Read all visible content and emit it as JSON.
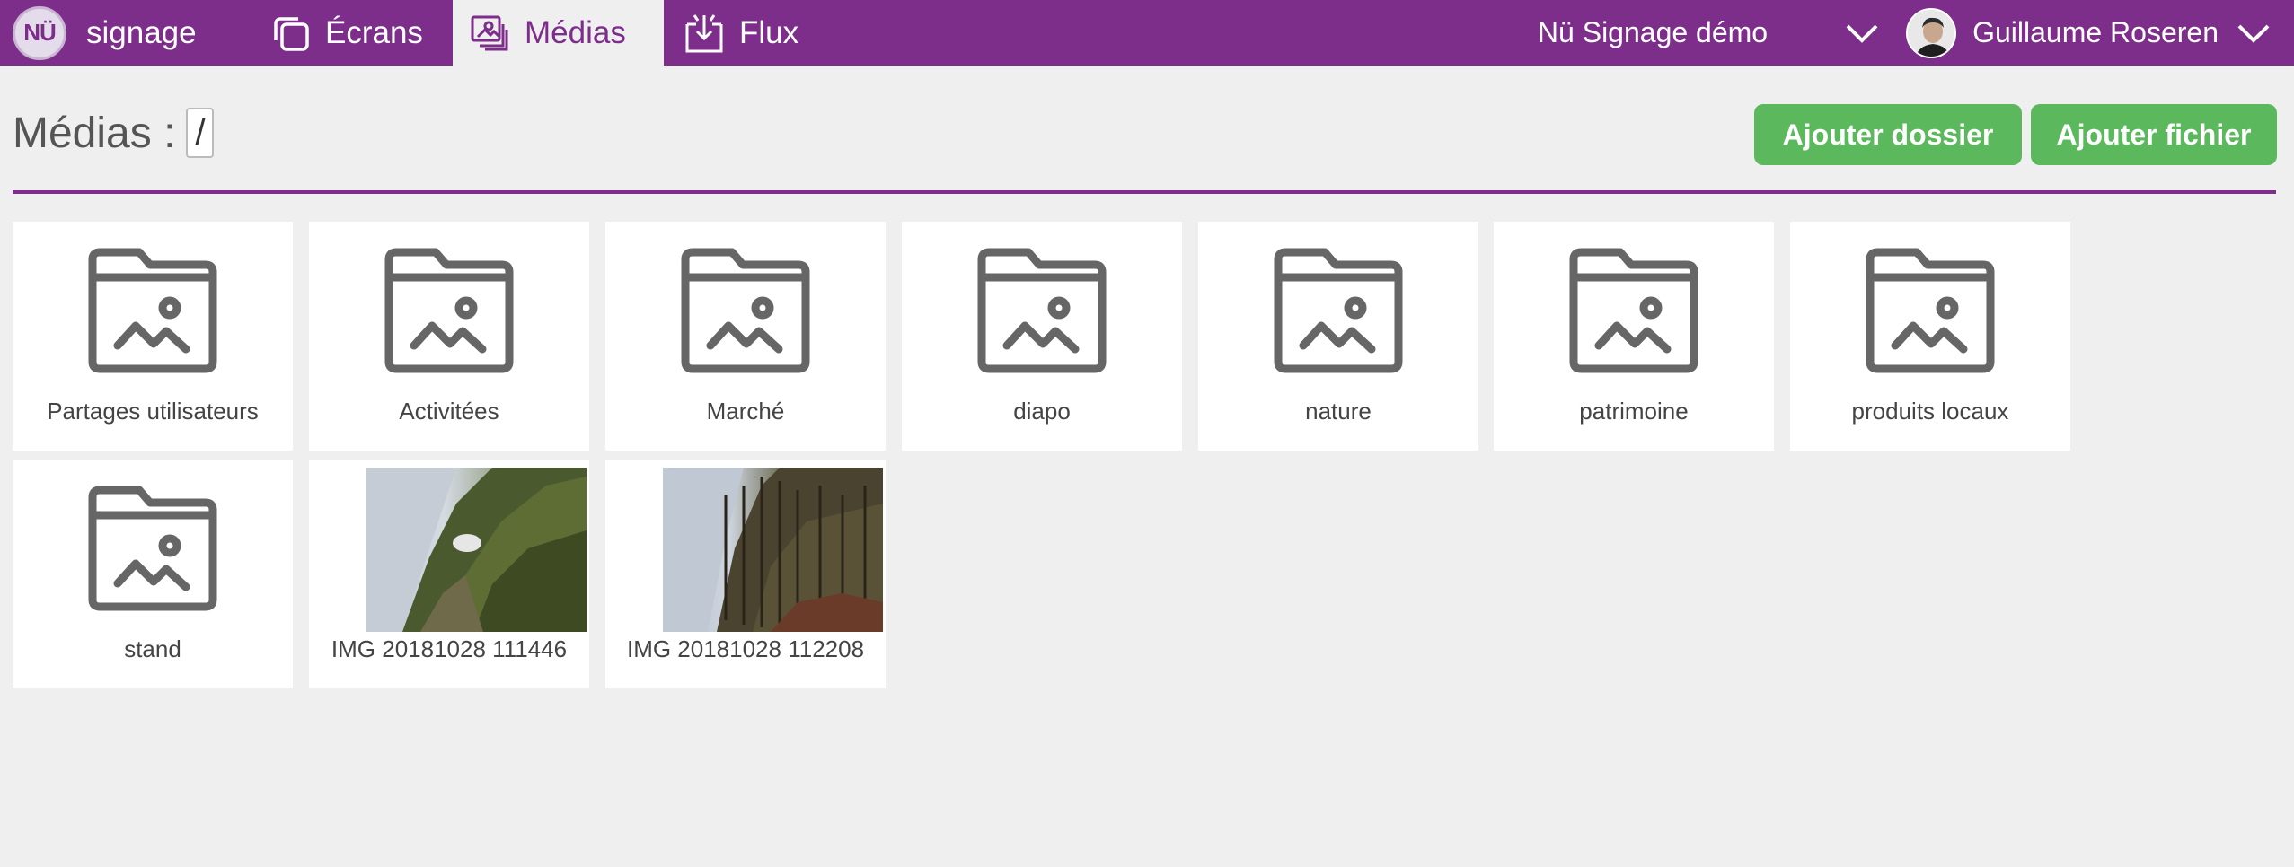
{
  "nav": {
    "logo_text": "NÜ",
    "brand": "signage",
    "tabs": [
      {
        "label": "Écrans",
        "icon": "screens-icon"
      },
      {
        "label": "Médias",
        "icon": "media-icon",
        "active": true
      },
      {
        "label": "Flux",
        "icon": "flux-icon"
      }
    ],
    "organization": "Nü Signage démo",
    "user": "Guillaume Roseren"
  },
  "page": {
    "title": "Médias :",
    "path": "/",
    "add_folder": "Ajouter dossier",
    "add_file": "Ajouter fichier"
  },
  "items": [
    {
      "type": "folder",
      "name": "Partages utilisateurs"
    },
    {
      "type": "folder",
      "name": "Activitées"
    },
    {
      "type": "folder",
      "name": "Marché"
    },
    {
      "type": "folder",
      "name": "diapo"
    },
    {
      "type": "folder",
      "name": "nature"
    },
    {
      "type": "folder",
      "name": "patrimoine"
    },
    {
      "type": "folder",
      "name": "produits locaux"
    },
    {
      "type": "folder",
      "name": "stand"
    },
    {
      "type": "image",
      "name": "IMG 20181028 111446"
    },
    {
      "type": "image",
      "name": "IMG 20181028 112208"
    }
  ],
  "colors": {
    "brand_purple": "#7d2e8a",
    "button_green": "#5cb85c",
    "background": "#efefef"
  }
}
